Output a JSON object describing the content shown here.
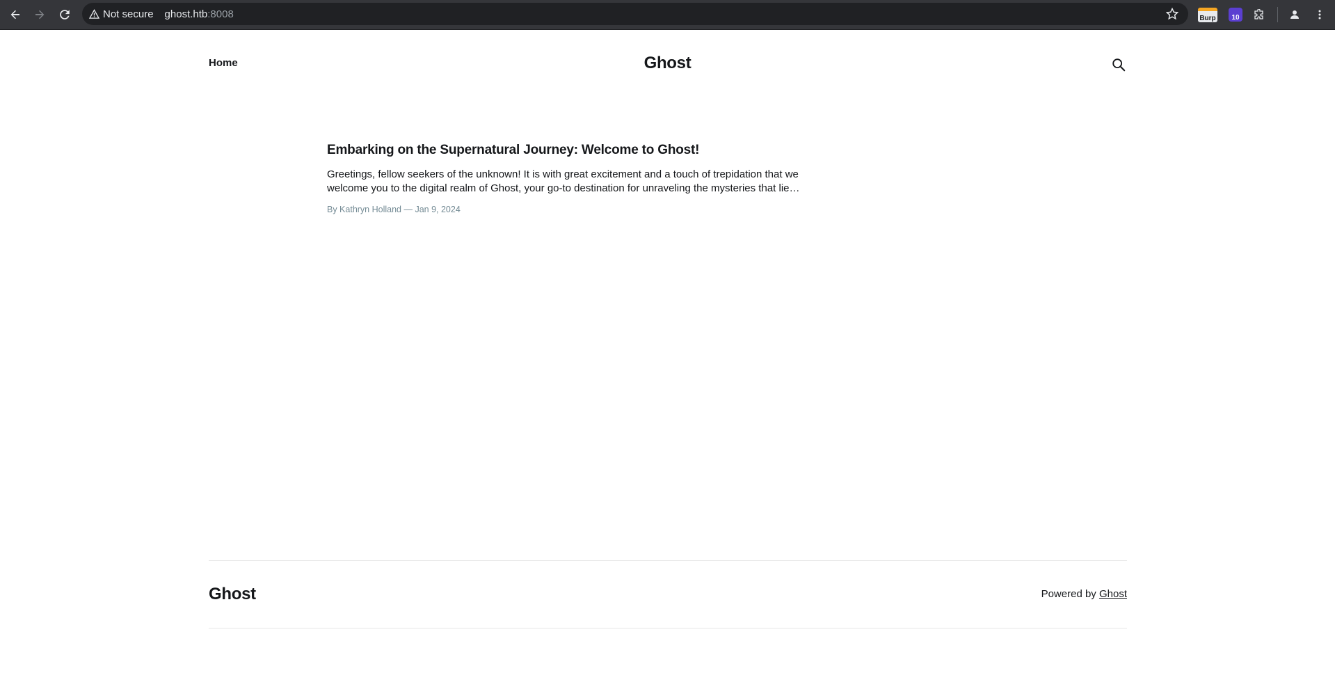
{
  "browser": {
    "security_label": "Not secure",
    "url_host": "ghost.htb",
    "url_port": ":8008",
    "extensions": {
      "burp_label": "Burp",
      "badge_count": "10"
    },
    "icons": [
      "back-arrow-icon",
      "forward-arrow-icon",
      "reload-icon",
      "warning-icon",
      "star-icon",
      "puzzle-icon",
      "profile-icon",
      "kebab-menu-icon"
    ]
  },
  "header": {
    "nav_home": "Home",
    "site_title": "Ghost"
  },
  "post": {
    "title": "Embarking on the Supernatural Journey: Welcome to Ghost!",
    "excerpt": "Greetings, fellow seekers of the unknown! It is with great excitement and a touch of trepidation that we welcome you to the digital realm of Ghost, your go-to destination for unraveling the mysteries that lie…",
    "meta": "By Kathryn Holland — Jan 9, 2024"
  },
  "footer": {
    "site_title": "Ghost",
    "powered_prefix": "Powered by ",
    "powered_link": "Ghost"
  }
}
